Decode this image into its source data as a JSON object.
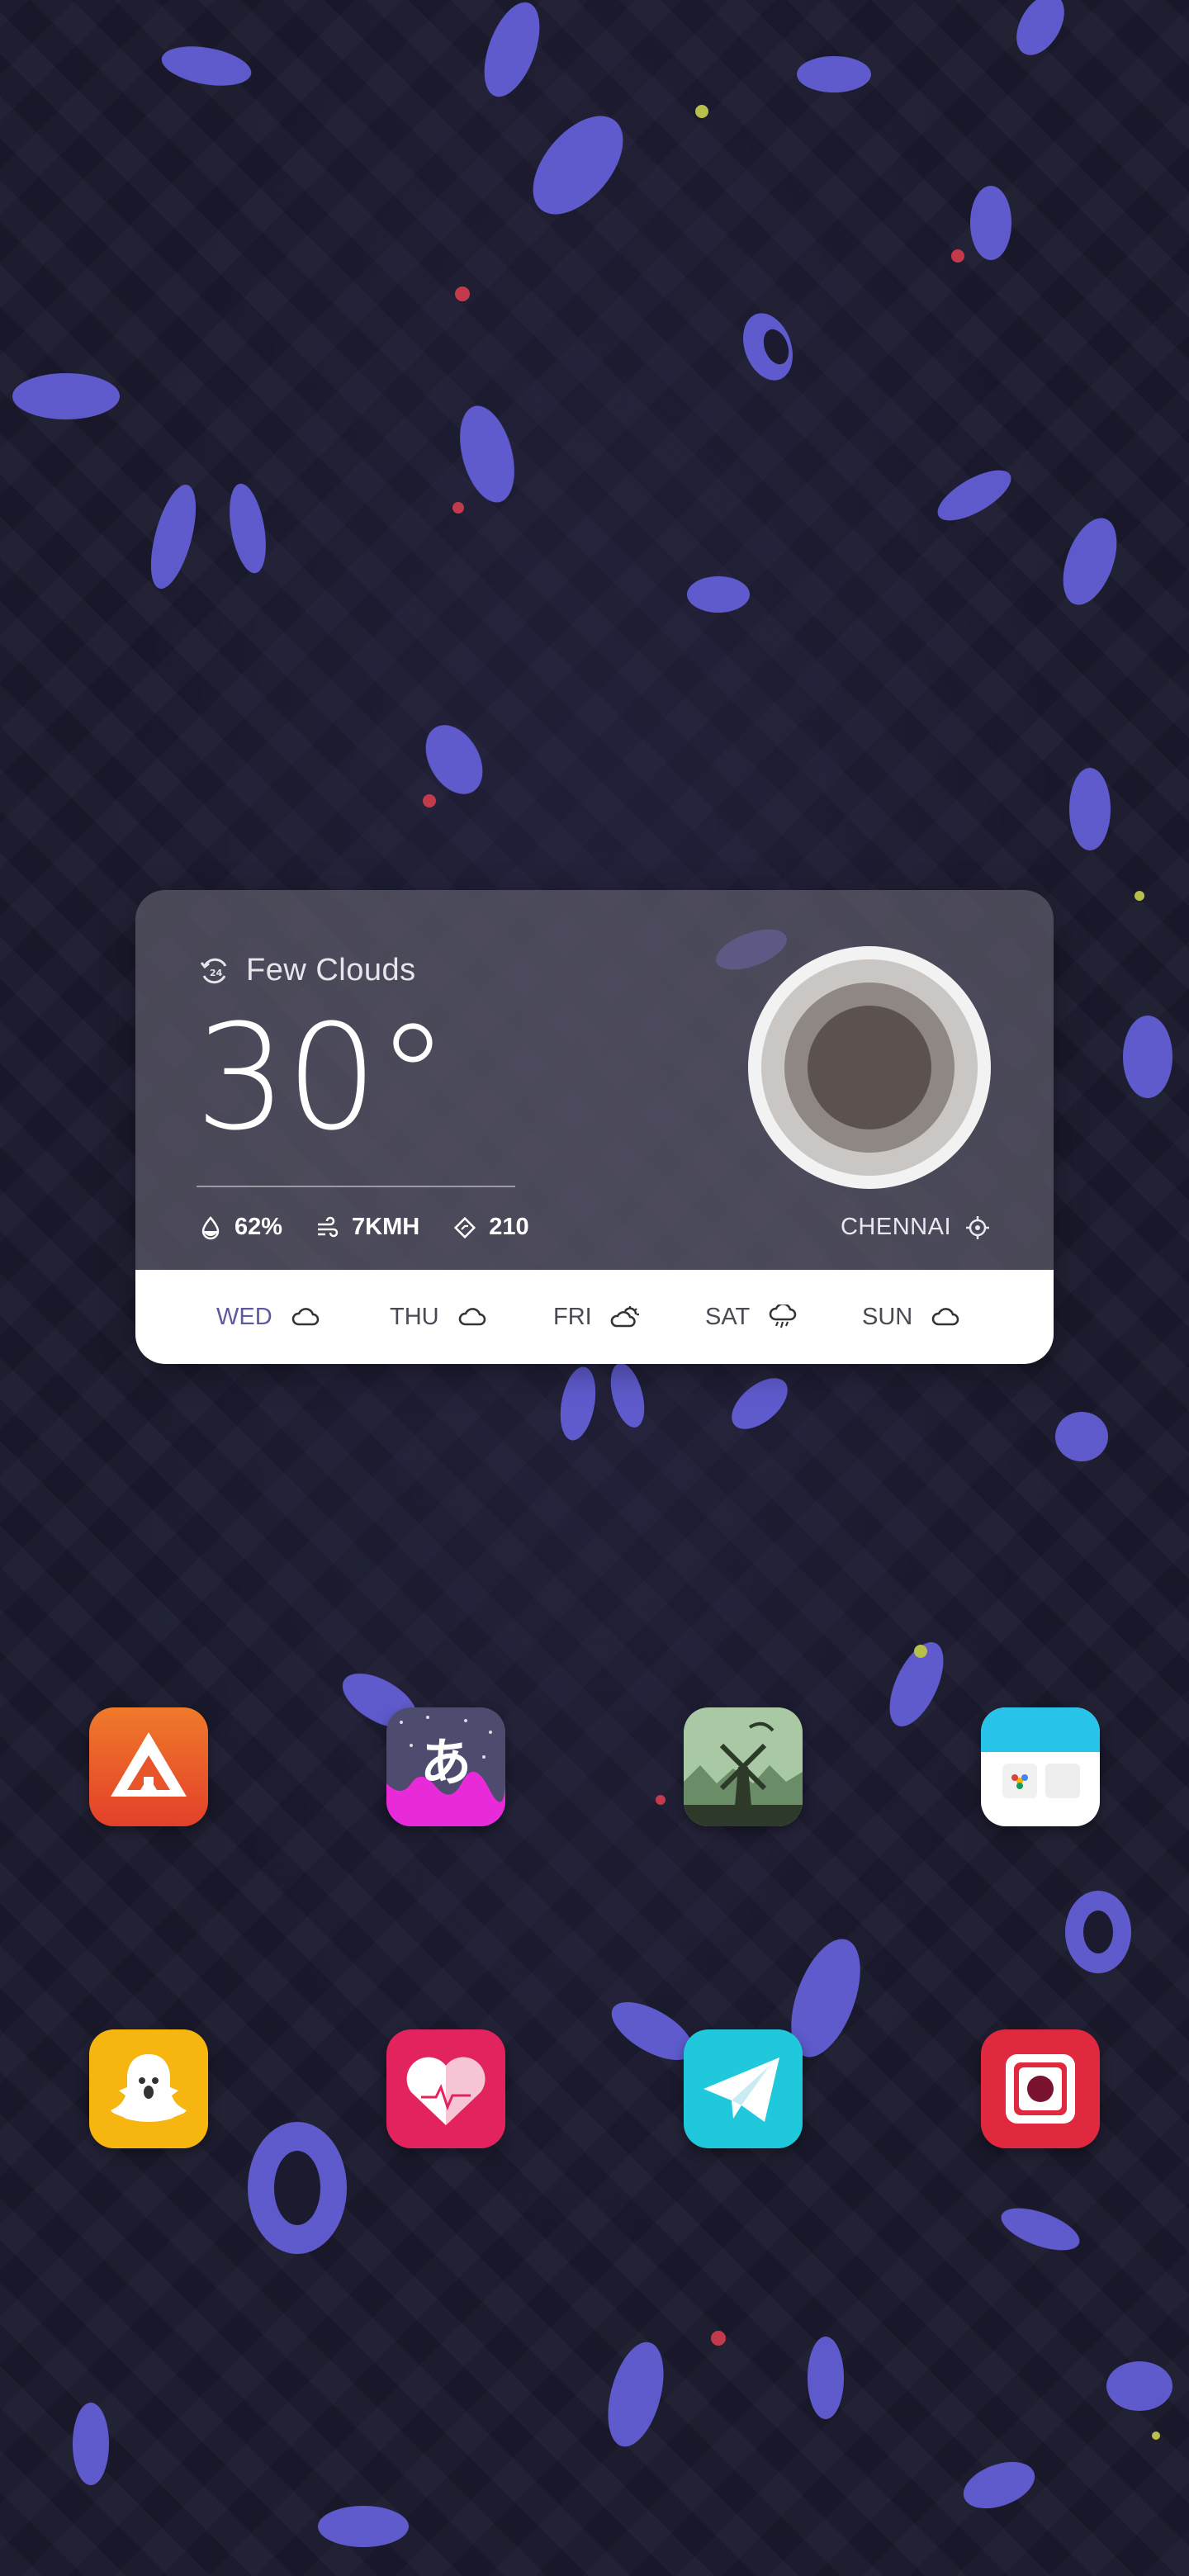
{
  "weather": {
    "condition": "Few Clouds",
    "temperature": "30°",
    "humidity": "62%",
    "wind": "7KMH",
    "direction": "210",
    "location": "CHENNAI",
    "forecast": [
      {
        "day": "WED",
        "icon": "cloud-icon"
      },
      {
        "day": "THU",
        "icon": "cloud-icon"
      },
      {
        "day": "FRI",
        "icon": "partly-cloudy-icon"
      },
      {
        "day": "SAT",
        "icon": "rain-cloud-icon"
      },
      {
        "day": "SUN",
        "icon": "cloud-icon"
      }
    ]
  },
  "apps": [
    {
      "icon": "triangle-logo-app-icon"
    },
    {
      "icon": "japanese-hiragana-app-icon"
    },
    {
      "icon": "windmill-game-app-icon"
    },
    {
      "icon": "photos-app-icon"
    },
    {
      "icon": "snapchat-app-icon"
    },
    {
      "icon": "health-heart-app-icon"
    },
    {
      "icon": "telegram-app-icon"
    },
    {
      "icon": "instagram-app-icon"
    }
  ],
  "colors": {
    "accent": "#5b5a9e",
    "wallpaper": "#1b1a2e",
    "petal": "#6a66e0"
  }
}
